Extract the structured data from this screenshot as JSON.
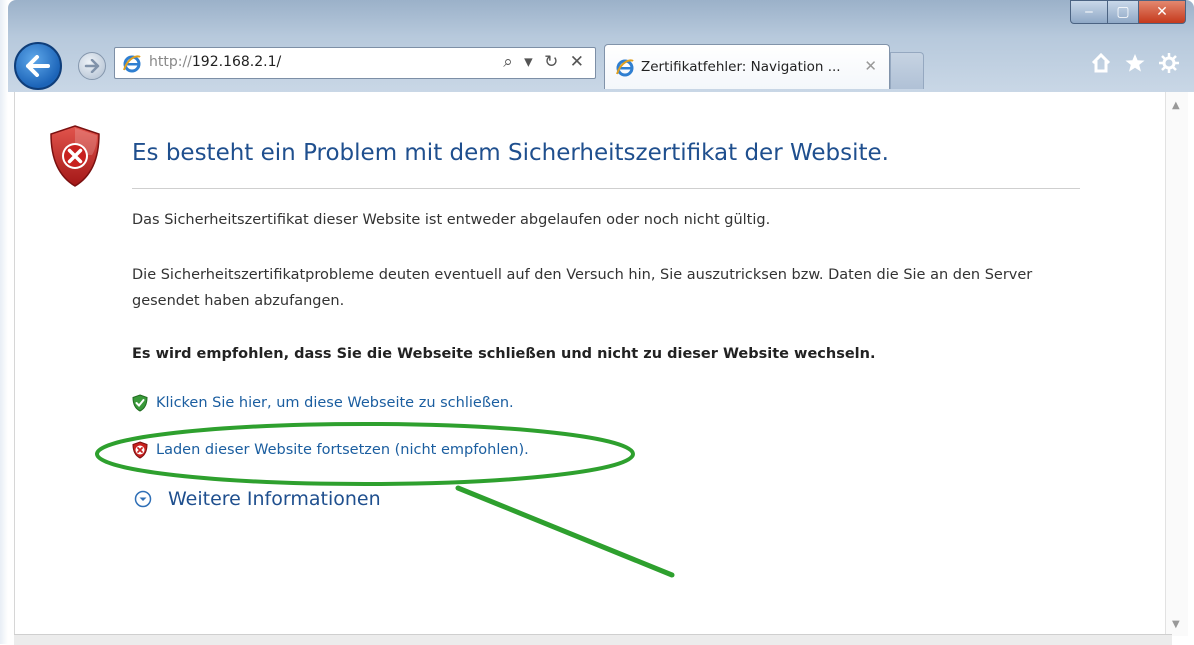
{
  "browser": {
    "url_prefix": "http://",
    "url_host": "192.168.2.1/",
    "address_actions": "⌕ ▾ ↻ ✕",
    "tab_label": "Zertifikatfehler: Navigation ...",
    "tab_close": "✕",
    "window_controls": {
      "minimize": "‒",
      "maximize": "▢",
      "close": "✕"
    },
    "icons": [
      "back-arrow-icon",
      "forward-arrow-icon",
      "ie-logo-icon",
      "home-icon",
      "favorites-star-icon",
      "gear-icon"
    ]
  },
  "page": {
    "title": "Es besteht ein Problem mit dem Sicherheitszertifikat der Website.",
    "para1": "Das Sicherheitszertifikat dieser Website ist entweder abgelaufen oder noch nicht gültig.",
    "para2": "Die Sicherheitszertifikatprobleme deuten eventuell auf den Versuch hin, Sie auszutricksen bzw. Daten die Sie an den Server gesendet haben abzufangen.",
    "recommendation": "Es wird empfohlen, dass Sie die Webseite schließen und nicht zu dieser Website wechseln.",
    "close_link": "Klicken Sie hier, um diese Webseite zu schließen.",
    "continue_link": "Laden dieser Website fortsetzen (nicht empfohlen).",
    "more_info": "Weitere Informationen"
  },
  "colors": {
    "title_blue": "#1f4f8e",
    "link_blue": "#1b5ea0",
    "error_red": "#c0282a",
    "ok_green": "#3a9a3a",
    "annotation_green": "#2ea02e"
  }
}
